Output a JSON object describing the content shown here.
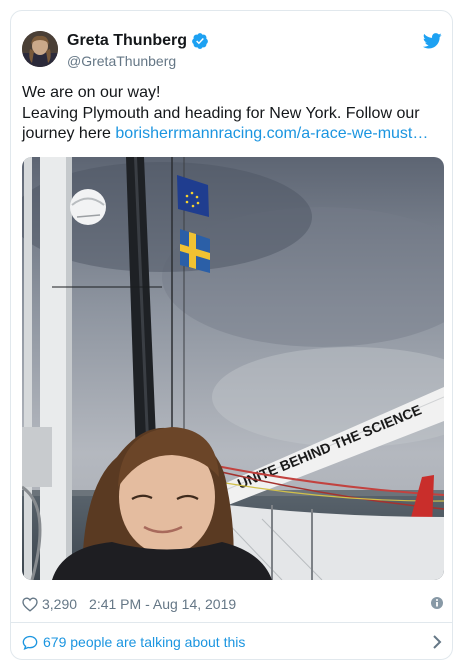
{
  "tweet": {
    "author": {
      "name": "Greta Thunberg",
      "handle": "@GretaThunberg",
      "verified": true,
      "avatar_icon": "profile-photo"
    },
    "platform_icon": "twitter-bird-icon",
    "text_line1": "We are on our way!",
    "text_line2": "Leaving Plymouth and heading for New York. Follow our",
    "text_line3_prefix": "journey here ",
    "link_text": "borisherrmannracing.com/a-race-we-must…",
    "photo": {
      "description_icon": "selfie-on-sailboat-photo",
      "sail_text": "UNITE BEHIND THE SCIENCE"
    },
    "likes": "3,290",
    "timestamp": "2:41 PM - Aug 14, 2019",
    "conversation": "679 people are talking about this"
  },
  "colors": {
    "link": "#1b95e0",
    "verified": "#1da1f2",
    "muted": "#657786",
    "border": "#e1e8ed"
  }
}
